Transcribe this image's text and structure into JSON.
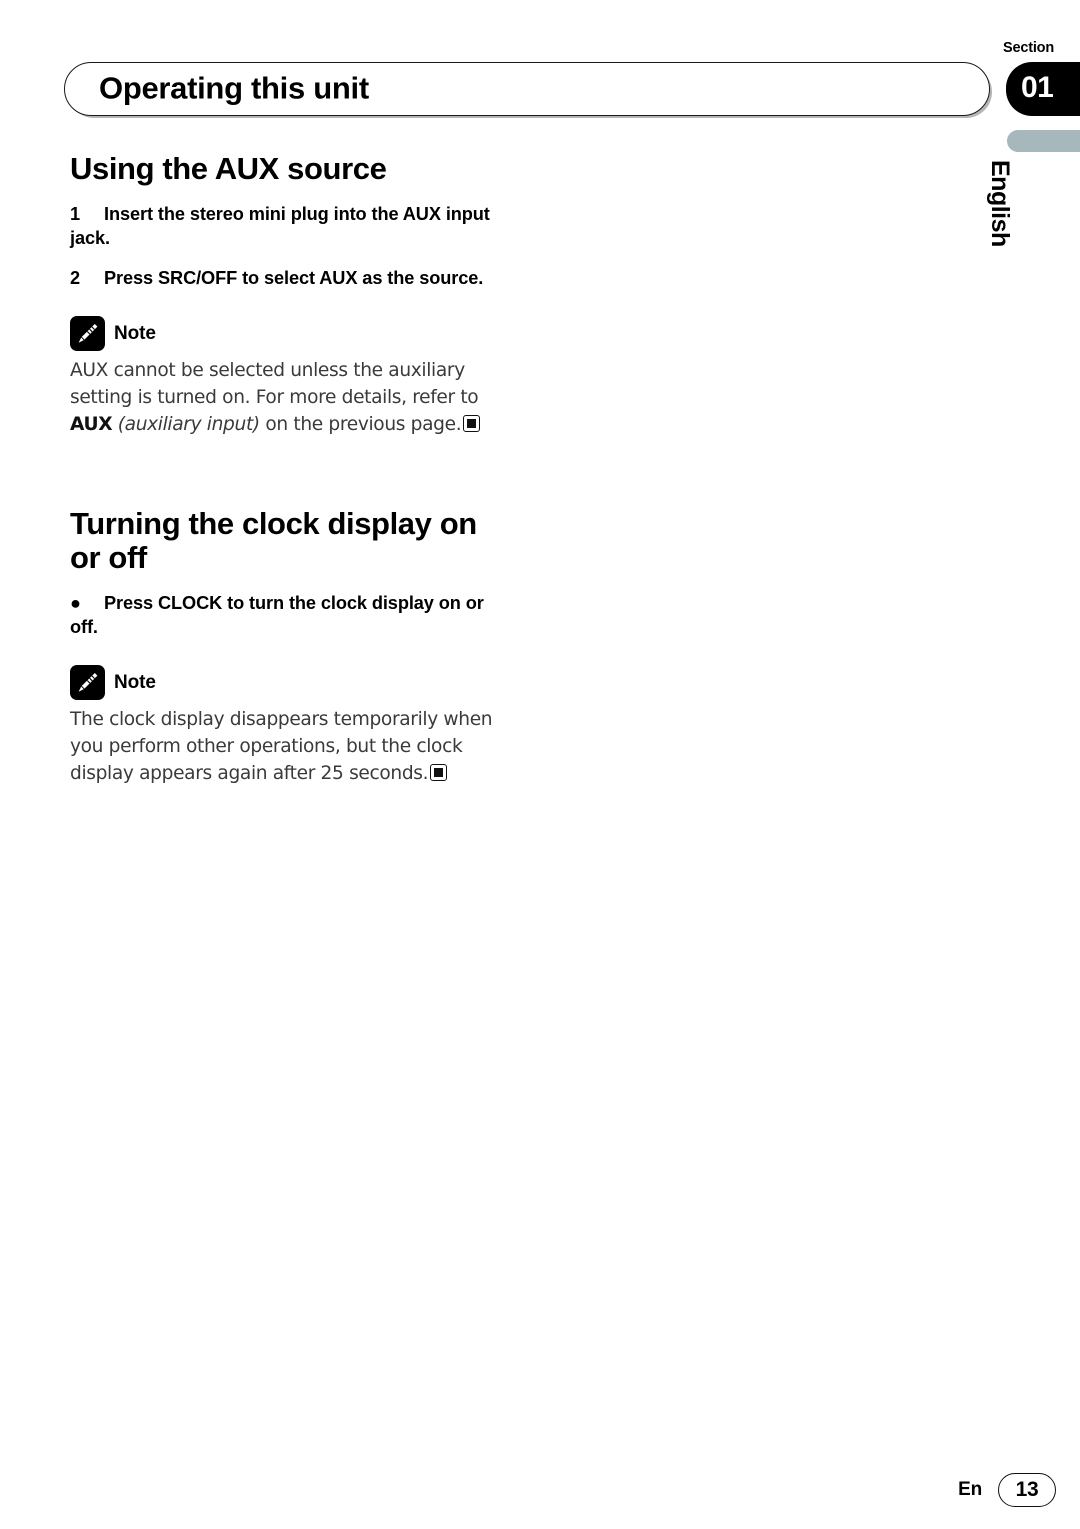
{
  "header": {
    "running_title": "Operating this unit",
    "section_label": "Section",
    "section_number": "01",
    "language_tab": "English"
  },
  "colors": {
    "section_tab_bg": "#000000",
    "language_tab_bg": "#a6b8bc",
    "body_text": "#3a3a3a",
    "heading_text": "#000000"
  },
  "content": {
    "sections": [
      {
        "heading": "Using the AUX source",
        "steps": [
          {
            "marker": "1",
            "text": "Insert the stereo mini plug into the AUX input jack."
          },
          {
            "marker": "2",
            "text": "Press SRC/OFF to select AUX as the source."
          }
        ],
        "note": {
          "label": "Note",
          "icon": "pencil-icon",
          "text_run_1": "AUX cannot be selected unless the auxiliary setting is turned on. For more details, refer to ",
          "text_bold": "AUX",
          "text_italic": "(auxiliary input)",
          "text_run_2": " on the previous page.",
          "end_marker": "end-of-note-marker"
        }
      },
      {
        "heading": "Turning the clock display on or off",
        "steps": [
          {
            "marker": "●",
            "text": "Press CLOCK to turn the clock display on or off."
          }
        ],
        "note": {
          "label": "Note",
          "icon": "pencil-icon",
          "text_run_1": "The clock display disappears temporarily when you perform other operations, but the clock display appears again after 25 seconds.",
          "end_marker": "end-of-note-marker"
        }
      }
    ]
  },
  "footer": {
    "language": "En",
    "page_number": "13"
  }
}
